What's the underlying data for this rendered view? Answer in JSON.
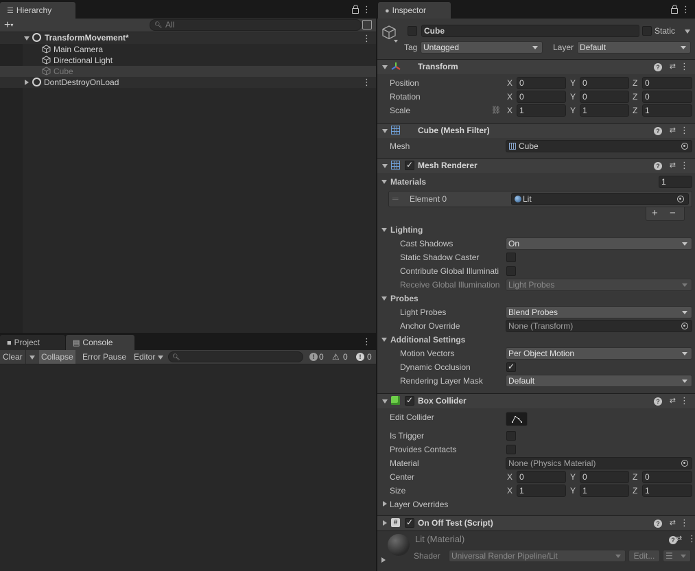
{
  "hierarchy": {
    "tab_label": "Hierarchy",
    "search_placeholder": "All",
    "scene_name": "TransformMovement*",
    "items": [
      "Main Camera",
      "Directional Light",
      "Cube"
    ],
    "dont_destroy": "DontDestroyOnLoad"
  },
  "bottom_tabs": {
    "project": "Project",
    "console": "Console"
  },
  "console": {
    "clear": "Clear",
    "collapse": "Collapse",
    "error_pause": "Error Pause",
    "editor": "Editor",
    "count_info": "0",
    "count_warn": "0",
    "count_error": "0"
  },
  "inspector": {
    "tab_label": "Inspector",
    "object_name": "Cube",
    "static_label": "Static",
    "tag_label": "Tag",
    "tag_value": "Untagged",
    "layer_label": "Layer",
    "layer_value": "Default",
    "transform": {
      "title": "Transform",
      "position_label": "Position",
      "rotation_label": "Rotation",
      "scale_label": "Scale",
      "position": [
        "0",
        "0",
        "0"
      ],
      "rotation": [
        "0",
        "0",
        "0"
      ],
      "scale": [
        "1",
        "1",
        "1"
      ],
      "x": "X",
      "y": "Y",
      "z": "Z"
    },
    "mesh_filter": {
      "title": "Cube (Mesh Filter)",
      "mesh_label": "Mesh",
      "mesh_value": "Cube"
    },
    "mesh_renderer": {
      "title": "Mesh Renderer",
      "materials_label": "Materials",
      "materials_count": "1",
      "element_label": "Element 0",
      "element_value": "Lit",
      "plus": "+",
      "minus": "−",
      "lighting_label": "Lighting",
      "cast_shadows_label": "Cast Shadows",
      "cast_shadows_value": "On",
      "static_shadow_label": "Static Shadow Caster",
      "contribute_gi_label": "Contribute Global Illuminati",
      "receive_gi_label": "Receive Global Illumination",
      "receive_gi_value": "Light Probes",
      "probes_label": "Probes",
      "light_probes_label": "Light Probes",
      "light_probes_value": "Blend Probes",
      "anchor_label": "Anchor Override",
      "anchor_value": "None (Transform)",
      "additional_label": "Additional Settings",
      "motion_label": "Motion Vectors",
      "motion_value": "Per Object Motion",
      "dynamic_occ_label": "Dynamic Occlusion",
      "rendering_mask_label": "Rendering Layer Mask",
      "rendering_mask_value": "Default"
    },
    "box_collider": {
      "title": "Box Collider",
      "edit_label": "Edit Collider",
      "trigger_label": "Is Trigger",
      "contacts_label": "Provides Contacts",
      "material_label": "Material",
      "material_value": "None (Physics Material)",
      "center_label": "Center",
      "size_label": "Size",
      "center": [
        "0",
        "0",
        "0"
      ],
      "size": [
        "1",
        "1",
        "1"
      ],
      "layer_overrides_label": "Layer Overrides"
    },
    "script": {
      "title": "On Off Test (Script)",
      "hash": "#"
    },
    "material": {
      "title": "Lit (Material)",
      "shader_label": "Shader",
      "shader_value": "Universal Render Pipeline/Lit",
      "edit_label": "Edit..."
    }
  }
}
